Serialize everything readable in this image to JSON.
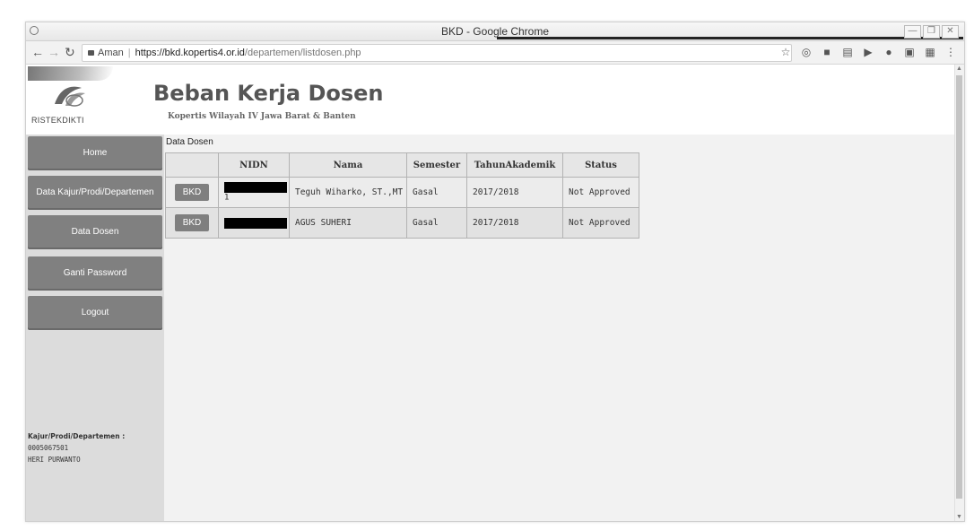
{
  "browser": {
    "window_title": "BKD - Google Chrome",
    "secure_label": "Aman",
    "url_host": "https://bkd.kopertis4.or.id",
    "url_path": "/departemen/listdosen.php"
  },
  "header": {
    "brand": "RISTEKDIKTI",
    "title": "Beban Kerja Dosen",
    "subtitle": "Kopertis Wilayah IV Jawa Barat & Banten"
  },
  "sidebar": {
    "items": [
      {
        "label": "Home"
      },
      {
        "label": "Data Kajur/Prodi/Departemen"
      },
      {
        "label": "Data Dosen"
      },
      {
        "label": "Ganti Password"
      },
      {
        "label": "Logout"
      }
    ],
    "user_label": "Kajur/Prodi/Departemen :",
    "user_id": "0005067501",
    "user_name": "HERI PURWANTO"
  },
  "main": {
    "breadcrumb": "Data Dosen",
    "columns": [
      "",
      "NIDN",
      "Nama",
      "Semester",
      "TahunAkademik",
      "Status"
    ],
    "rows": [
      {
        "action": "BKD",
        "nidn_tail": "1",
        "nama": "Teguh Wiharko, ST.,MT",
        "semester": "Gasal",
        "tahun": "2017/2018",
        "status": "Not Approved"
      },
      {
        "action": "BKD",
        "nidn_tail": "",
        "nama": "AGUS SUHERI",
        "semester": "Gasal",
        "tahun": "2017/2018",
        "status": "Not Approved"
      }
    ]
  }
}
